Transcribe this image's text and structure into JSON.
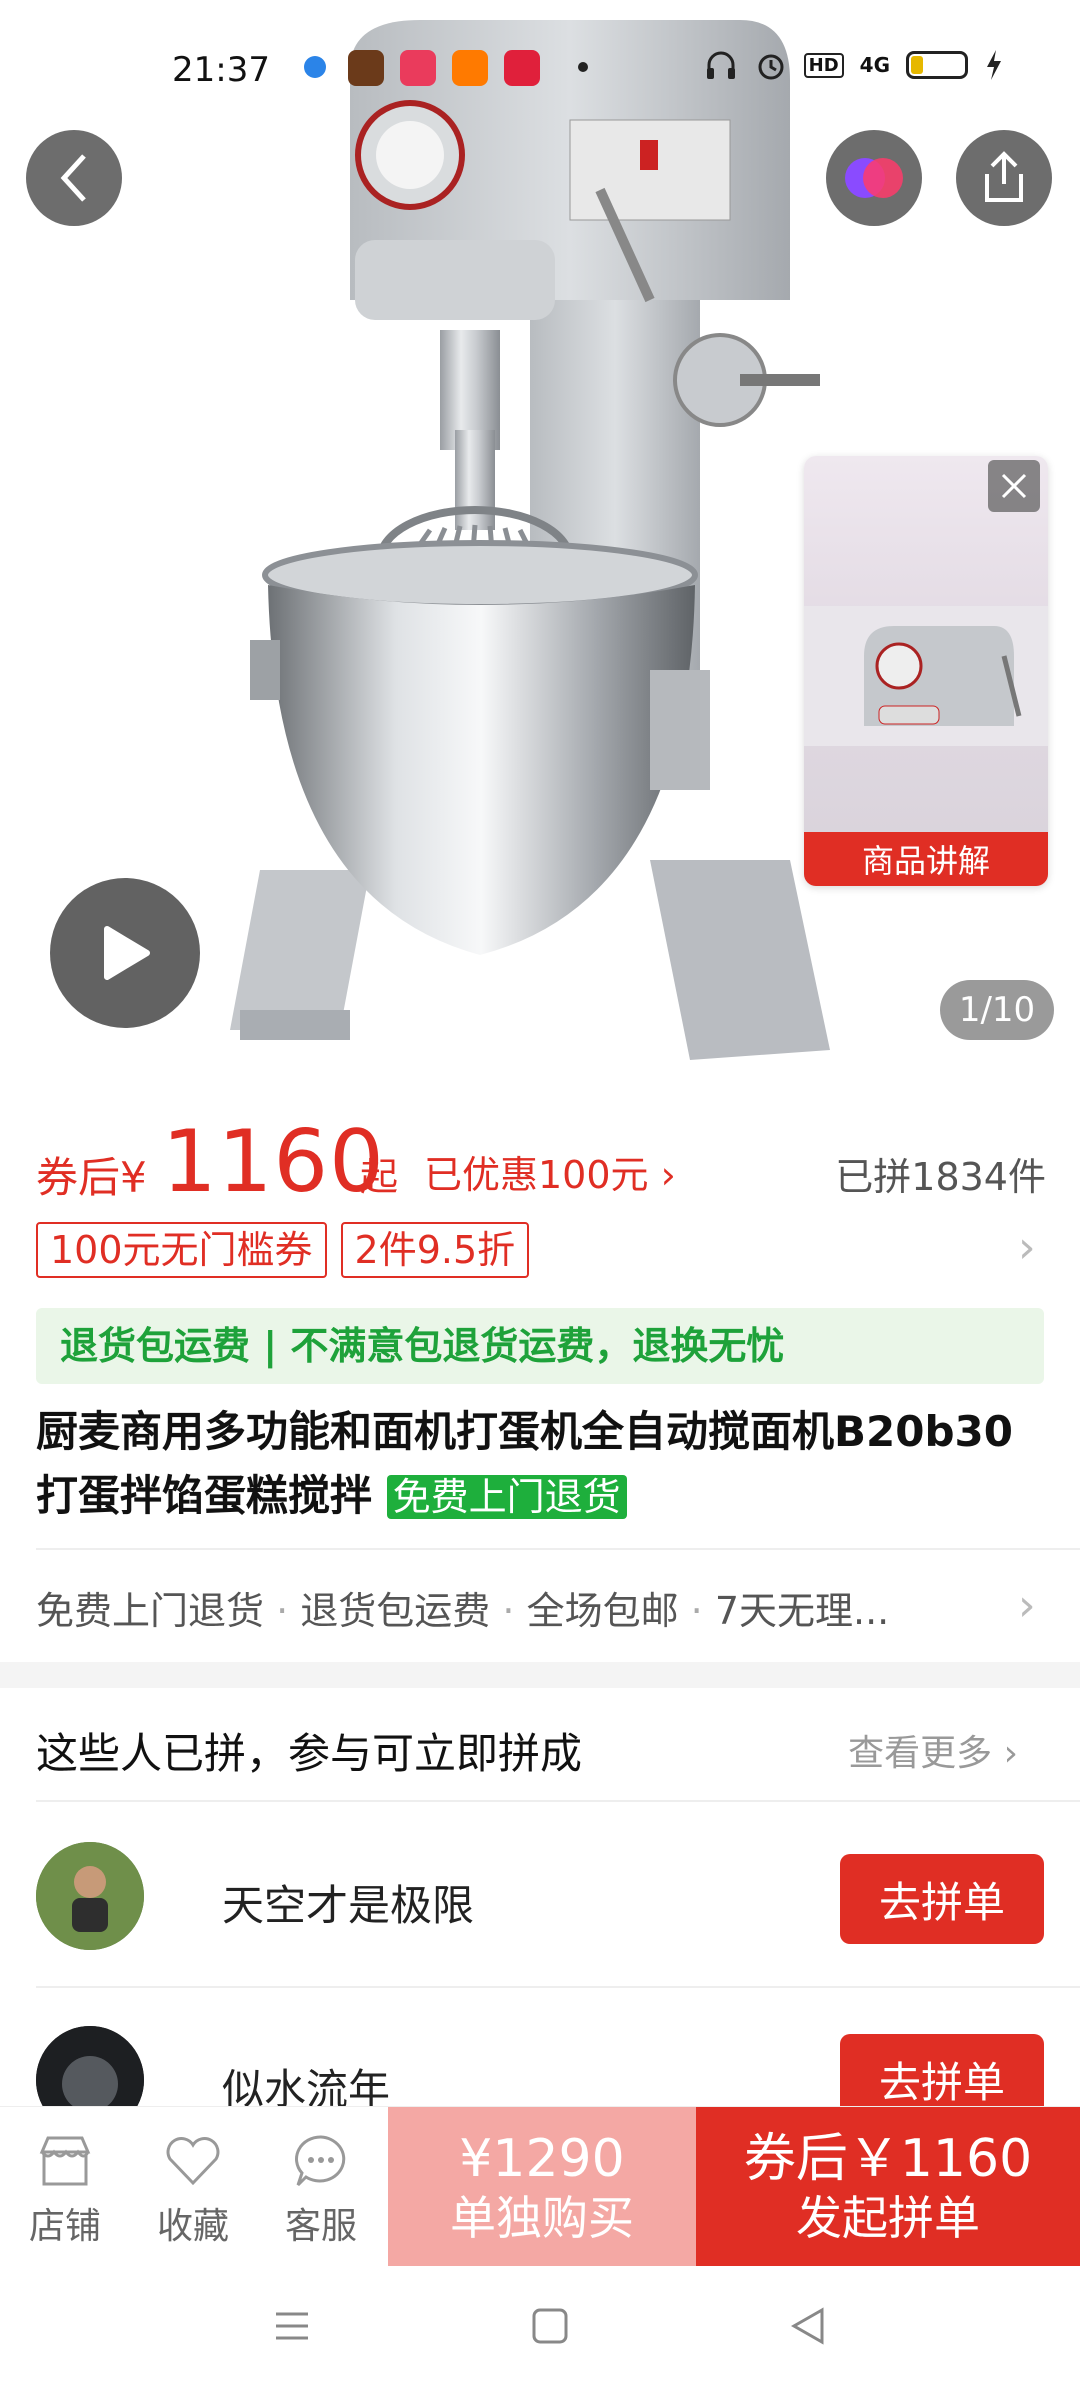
{
  "status_bar": {
    "time": "21:37",
    "icons": [
      "headphones-icon",
      "alarm-icon",
      "hd-icon",
      "4g-signal-icon",
      "battery-icon",
      "charging-icon"
    ],
    "network": "4G",
    "hd": "HD"
  },
  "media": {
    "counter": "1/10",
    "float_label": "商品讲解"
  },
  "price": {
    "prefix": "券后¥",
    "amount": "1160",
    "suffix": "起",
    "saving": "已优惠100元",
    "joined": "已拼1834件"
  },
  "coupons": [
    "100元无门槛券",
    "2件9.5折"
  ],
  "return_bar": "退货包运费 | 不满意包退货运费，退换无忧",
  "product": {
    "title": "厨麦商用多功能和面机打蛋机全自动搅面机B20b30打蛋拌馅蛋糕搅拌",
    "tag": "免费上门退货"
  },
  "services": [
    "免费上门退货",
    "退货包运费",
    "全场包邮",
    "7天无理..."
  ],
  "group_section": {
    "title": "这些人已拼，参与可立即拼成",
    "more": "查看更多",
    "people": [
      {
        "name": "天空才是极限",
        "button": "去拼单"
      },
      {
        "name": "似水流年",
        "button": "去拼单"
      }
    ]
  },
  "bottom_bar": {
    "store": "店铺",
    "favorite": "收藏",
    "service": "客服",
    "single_price": "¥1290",
    "single_label": "单独购买",
    "group_price": "券后￥1160",
    "group_label": "发起拼单"
  },
  "colors": {
    "accent": "#e02e24",
    "green": "#1eaf3c",
    "pink": "#f4a8a4"
  }
}
